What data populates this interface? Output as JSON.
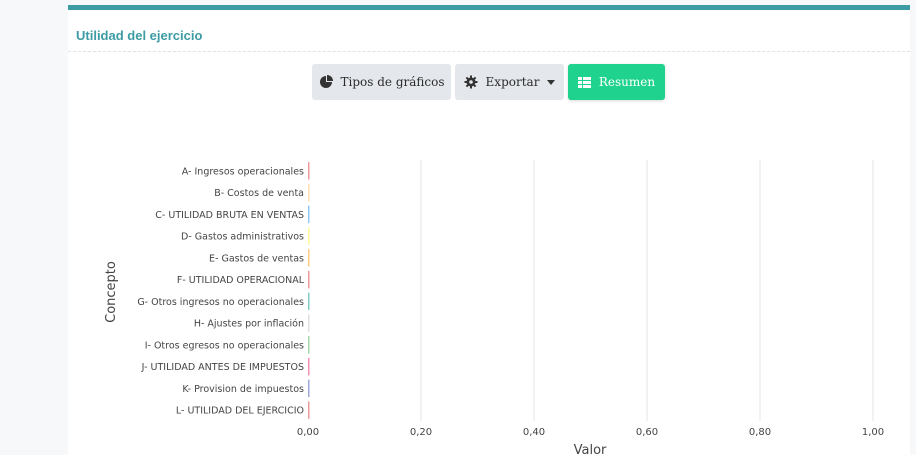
{
  "card": {
    "title": "Utilidad del ejercicio"
  },
  "toolbar": {
    "chart_types_label": "Tipos de gráficos",
    "export_label": "Exportar",
    "summary_label": "Resumen"
  },
  "colors": {
    "accent": "#3d9ba3",
    "summary_button": "#1fd38f"
  },
  "chart_data": {
    "type": "bar",
    "orientation": "horizontal",
    "categories": [
      "A- Ingresos operacionales",
      "B- Costos de venta",
      "C- UTILIDAD BRUTA EN VENTAS",
      "D- Gastos administrativos",
      "E- Gastos de ventas",
      "F- UTILIDAD OPERACIONAL",
      "G- Otros ingresos no operacionales",
      "H- Ajustes por inflación",
      "I- Otros egresos no operacionales",
      "J- UTILIDAD ANTES DE IMPUESTOS",
      "K- Provision de impuestos",
      "L- UTILIDAD DEL EJERCICIO"
    ],
    "values": [
      0,
      0,
      0,
      0,
      0,
      0,
      0,
      0,
      0,
      0,
      0,
      0
    ],
    "colors": [
      "#ef9a9a",
      "#ffe0b2",
      "#90caf9",
      "#fff59d",
      "#ffcc80",
      "#ef9a9a",
      "#80cbc4",
      "#e0e0e0",
      "#a5d6a7",
      "#f48fb1",
      "#9fa8da",
      "#ef9a9a"
    ],
    "xlabel": "Valor",
    "ylabel": "Concepto",
    "xlim": [
      0,
      1
    ],
    "xticks": [
      "0,00",
      "0,20",
      "0,40",
      "0,60",
      "0,80",
      "1,00"
    ],
    "grid": true
  }
}
